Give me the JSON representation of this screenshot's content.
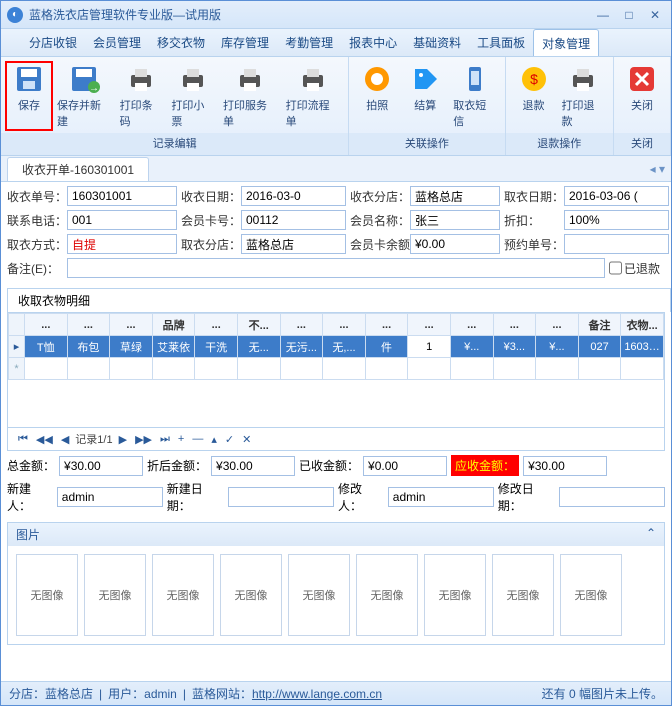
{
  "title": "蓝格洗衣店管理软件专业版—试用版",
  "menus": [
    "分店收银",
    "会员管理",
    "移交衣物",
    "库存管理",
    "考勤管理",
    "报表中心",
    "基础资料",
    "工具面板",
    "对象管理"
  ],
  "ribbon": {
    "groups": [
      {
        "label": "记录编辑",
        "buttons": [
          {
            "name": "save",
            "label": "保存"
          },
          {
            "name": "save-new",
            "label": "保存并新建"
          },
          {
            "name": "print-barcode",
            "label": "打印条码"
          },
          {
            "name": "print-ticket",
            "label": "打印小票"
          },
          {
            "name": "print-service",
            "label": "打印服务单"
          },
          {
            "name": "print-flow",
            "label": "打印流程单"
          }
        ]
      },
      {
        "label": "关联操作",
        "buttons": [
          {
            "name": "photo",
            "label": "拍照"
          },
          {
            "name": "settle",
            "label": "结算"
          },
          {
            "name": "sms",
            "label": "取衣短信"
          }
        ]
      },
      {
        "label": "退款操作",
        "buttons": [
          {
            "name": "refund",
            "label": "退款"
          },
          {
            "name": "print-refund",
            "label": "打印退款"
          }
        ]
      },
      {
        "label": "关闭",
        "buttons": [
          {
            "name": "close",
            "label": "关闭"
          }
        ]
      }
    ]
  },
  "docTab": "收衣开单-160301001",
  "form": {
    "labels": {
      "orderNo": "收衣单号：",
      "date": "收衣日期：",
      "branch": "收衣分店：",
      "pickupDate": "取衣日期：",
      "phone": "联系电话：",
      "cardNo": "会员卡号：",
      "memberName": "会员名称：",
      "discount": "折扣：",
      "pickupMethod": "取衣方式：",
      "pickupBranch": "取衣分店：",
      "cardBalance": "会员卡余额：",
      "reserveNo": "预约单号：",
      "remark": "备注(E)：",
      "refunded": "已退款"
    },
    "values": {
      "orderNo": "160301001",
      "date": "2016-03-0",
      "branch": "蓝格总店",
      "pickupDate": "2016-03-06 (",
      "phone": "001",
      "cardNo": "00112",
      "memberName": "张三",
      "discount": "100%",
      "pickupMethod": "自提",
      "pickupBranch": "蓝格总店",
      "cardBalance": "¥0.00",
      "reserveNo": "",
      "remark": ""
    }
  },
  "detailTab": "收取衣物明细",
  "grid": {
    "headers": [
      "...",
      "...",
      "...",
      "品牌",
      "...",
      "不...",
      "...",
      "...",
      "...",
      "...",
      "...",
      "...",
      "...",
      "备注",
      "衣物..."
    ],
    "rows": [
      {
        "cells": [
          "T恤",
          "布包",
          "草绿",
          "艾莱依",
          "干洗",
          "无...",
          "无污...",
          "无,...",
          "件",
          "1",
          "¥...",
          "¥3...",
          "¥...",
          "027",
          "160301 0..."
        ]
      }
    ]
  },
  "nav": {
    "record": "记录1/1"
  },
  "totals": {
    "labels": {
      "total": "总金额：",
      "afterDiscount": "折后金额：",
      "received": "已收金额：",
      "due": "应收金额：",
      "creator": "新建人：",
      "createDate": "新建日期：",
      "modifier": "修改人：",
      "modifyDate": "修改日期："
    },
    "values": {
      "total": "¥30.00",
      "afterDiscount": "¥30.00",
      "received": "¥0.00",
      "due": "¥30.00",
      "creator": "admin",
      "createDate": "",
      "modifier": "admin",
      "modifyDate": ""
    }
  },
  "imagePanel": {
    "title": "图片",
    "thumb": "无图像",
    "count": 9
  },
  "status": {
    "branch": "分店：蓝格总店",
    "user": "用户：admin",
    "siteLabel": "蓝格网站：",
    "siteUrl": "http://www.lange.com.cn",
    "right": "还有 0 幅图片未上传。"
  }
}
